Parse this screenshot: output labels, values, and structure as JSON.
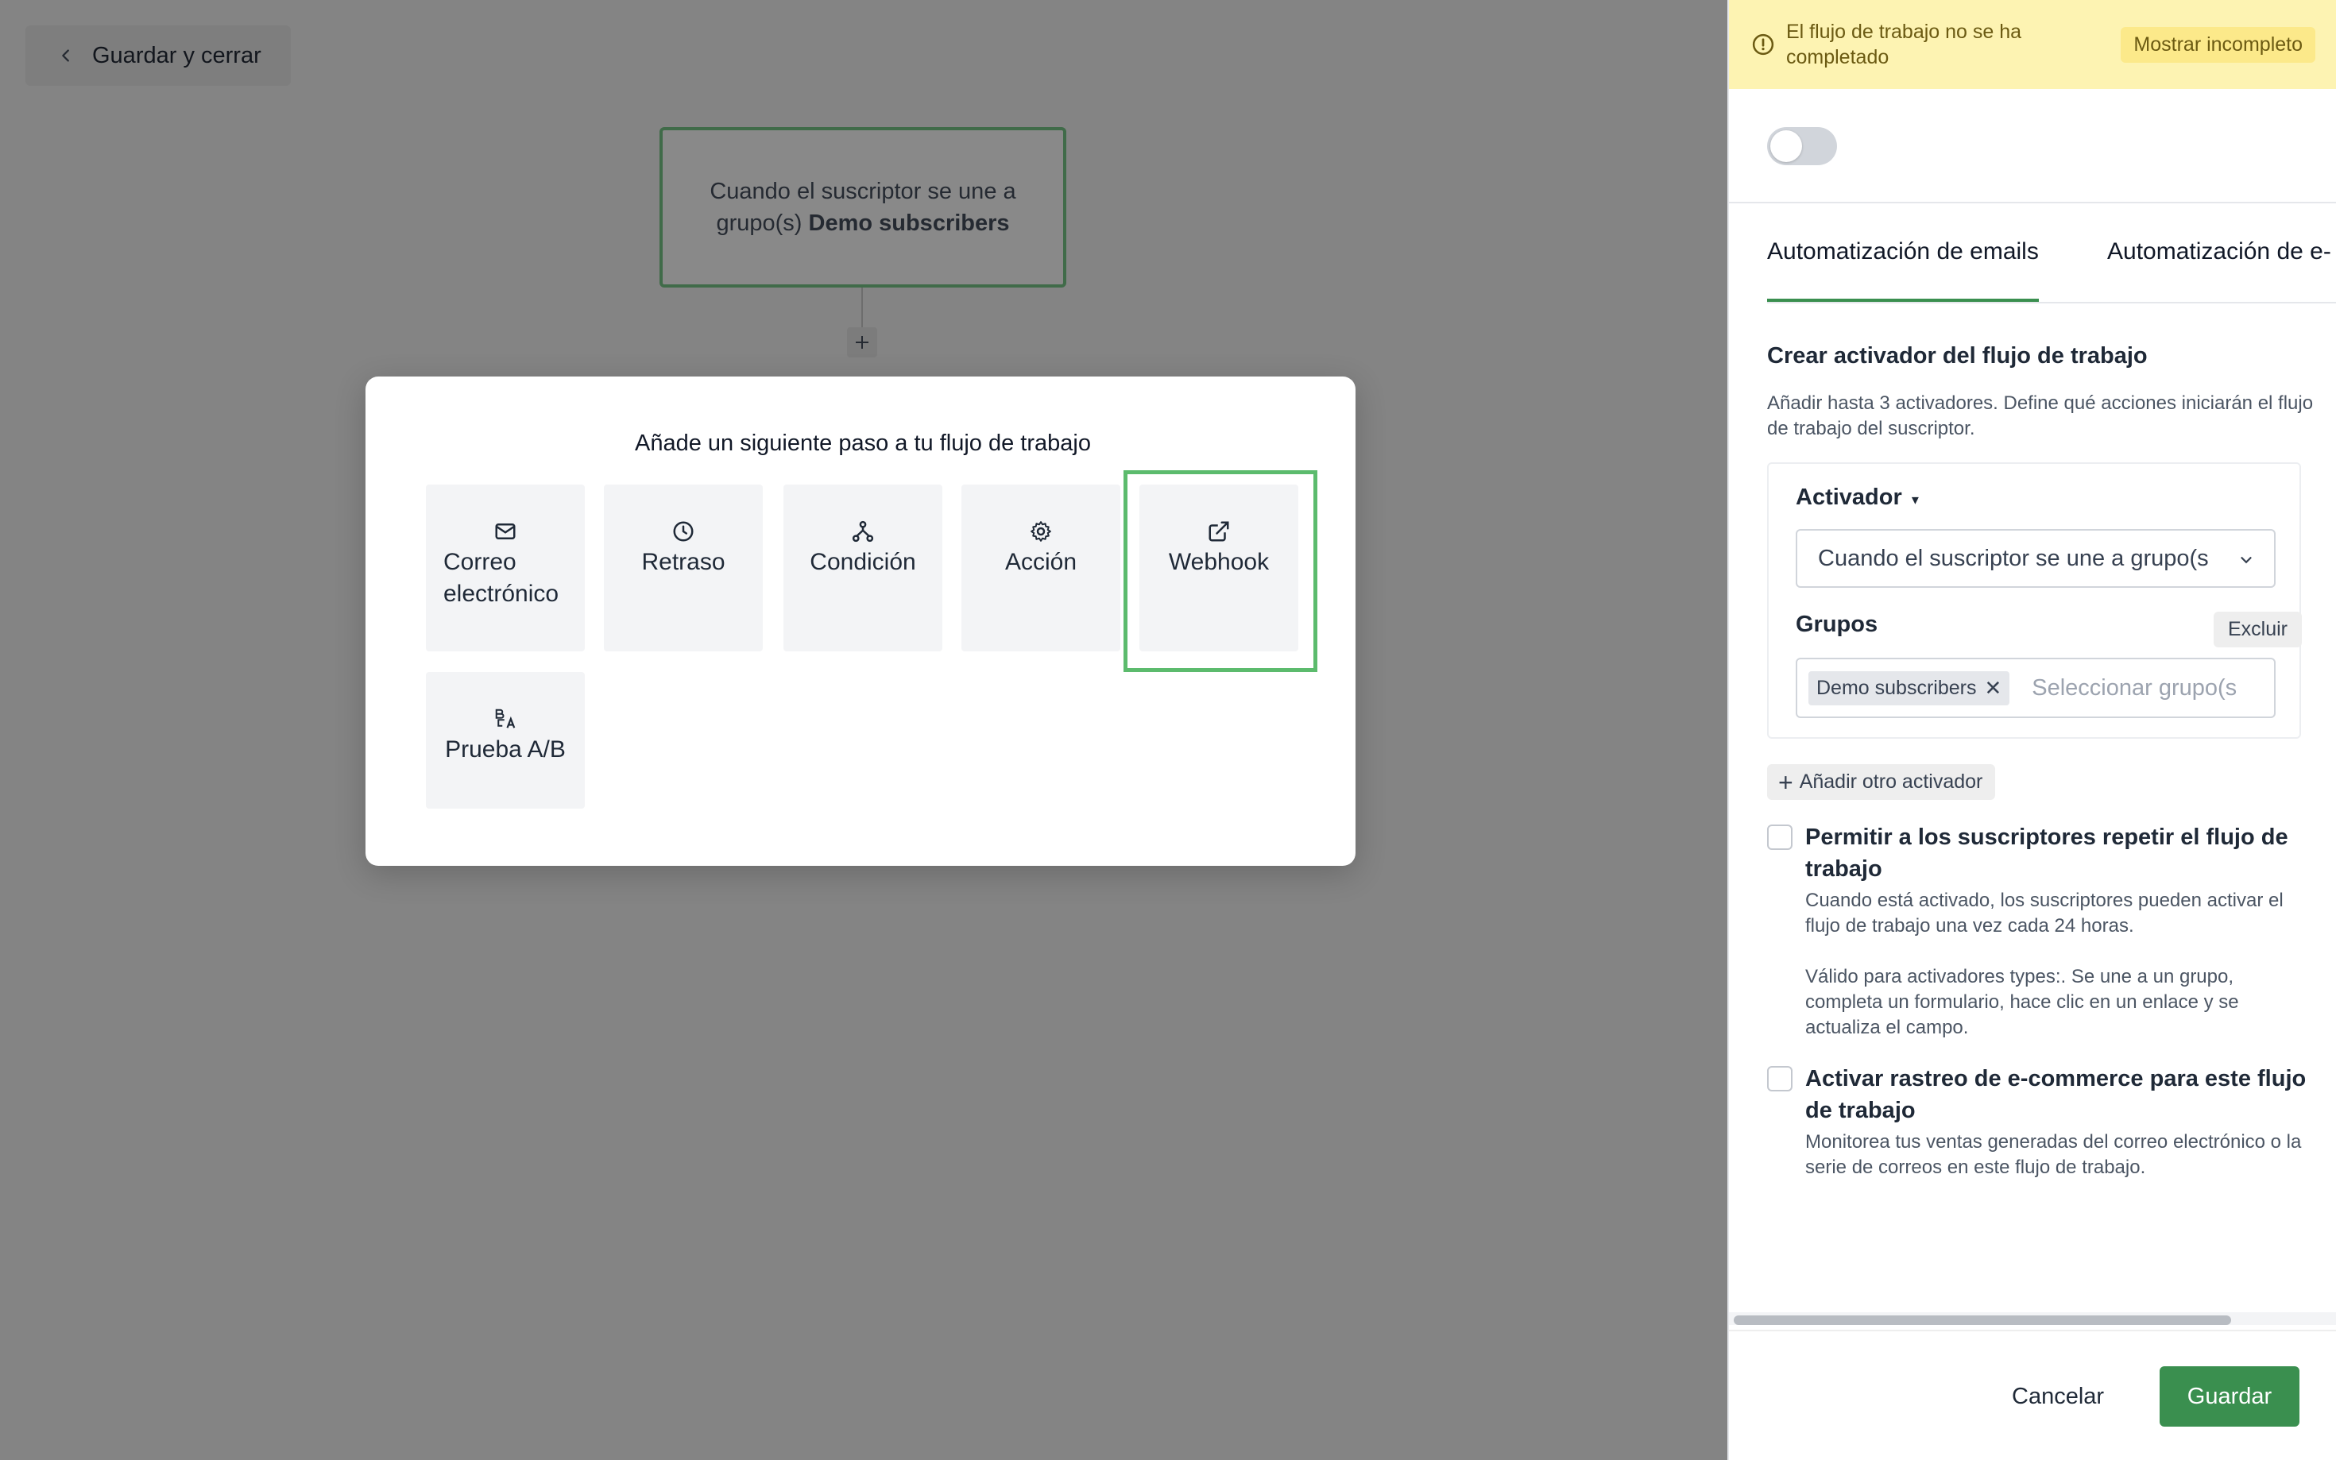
{
  "canvas": {
    "back_label": "Guardar y cerrar",
    "trigger_node": {
      "text_prefix": "Cuando el suscriptor se une a grupo(s)",
      "text_bold": "Demo subscribers"
    }
  },
  "modal": {
    "title": "Añade un siguiente paso a tu flujo de trabajo",
    "steps": [
      {
        "label": "Correo electrónico",
        "icon": "mail-icon"
      },
      {
        "label": "Retraso",
        "icon": "clock-icon"
      },
      {
        "label": "Condición",
        "icon": "branch-icon"
      },
      {
        "label": "Acción",
        "icon": "gear-icon"
      },
      {
        "label": "Webhook",
        "icon": "external-link-icon"
      },
      {
        "label": "Prueba A/B",
        "icon": "ab-test-icon"
      }
    ]
  },
  "panel": {
    "warning": {
      "text": "El flujo de trabajo no se ha completado",
      "button": "Mostrar incompleto",
      "color": "#fdf3b2"
    },
    "tabs": [
      {
        "label": "Automatización de emails",
        "active": true
      },
      {
        "label": "Automatización de e-",
        "active": false
      }
    ],
    "section_title": "Crear activador del flujo de trabajo",
    "section_desc": "Añadir hasta 3 activadores. Define qué acciones iniciarán el flujo de trabajo del suscriptor.",
    "trigger_label": "Activador",
    "trigger_value": "Cuando el suscriptor se une a grupo(s",
    "groups_label": "Grupos",
    "exclude_label": "Excluir",
    "group_chip": "Demo subscribers",
    "group_placeholder": "Seleccionar grupo(s",
    "add_trigger": "Añadir otro activador",
    "option_repeat": {
      "title": "Permitir a los suscriptores repetir el flujo de trabajo",
      "desc1": "Cuando está activado, los suscriptores pueden activar el flujo de trabajo una vez cada 24 horas.",
      "desc2": "Válido para activadores types:. Se une a un grupo, completa un formulario, hace clic en un enlace y se actualiza el campo."
    },
    "option_ecommerce": {
      "title": "Activar rastreo de e-commerce para este flujo de trabajo",
      "desc": "Monitorea tus ventas generadas del correo electrónico o la serie de correos en este flujo de trabajo."
    },
    "cancel_label": "Cancelar",
    "save_label": "Guardar",
    "accent_color": "#3a8f4f"
  }
}
